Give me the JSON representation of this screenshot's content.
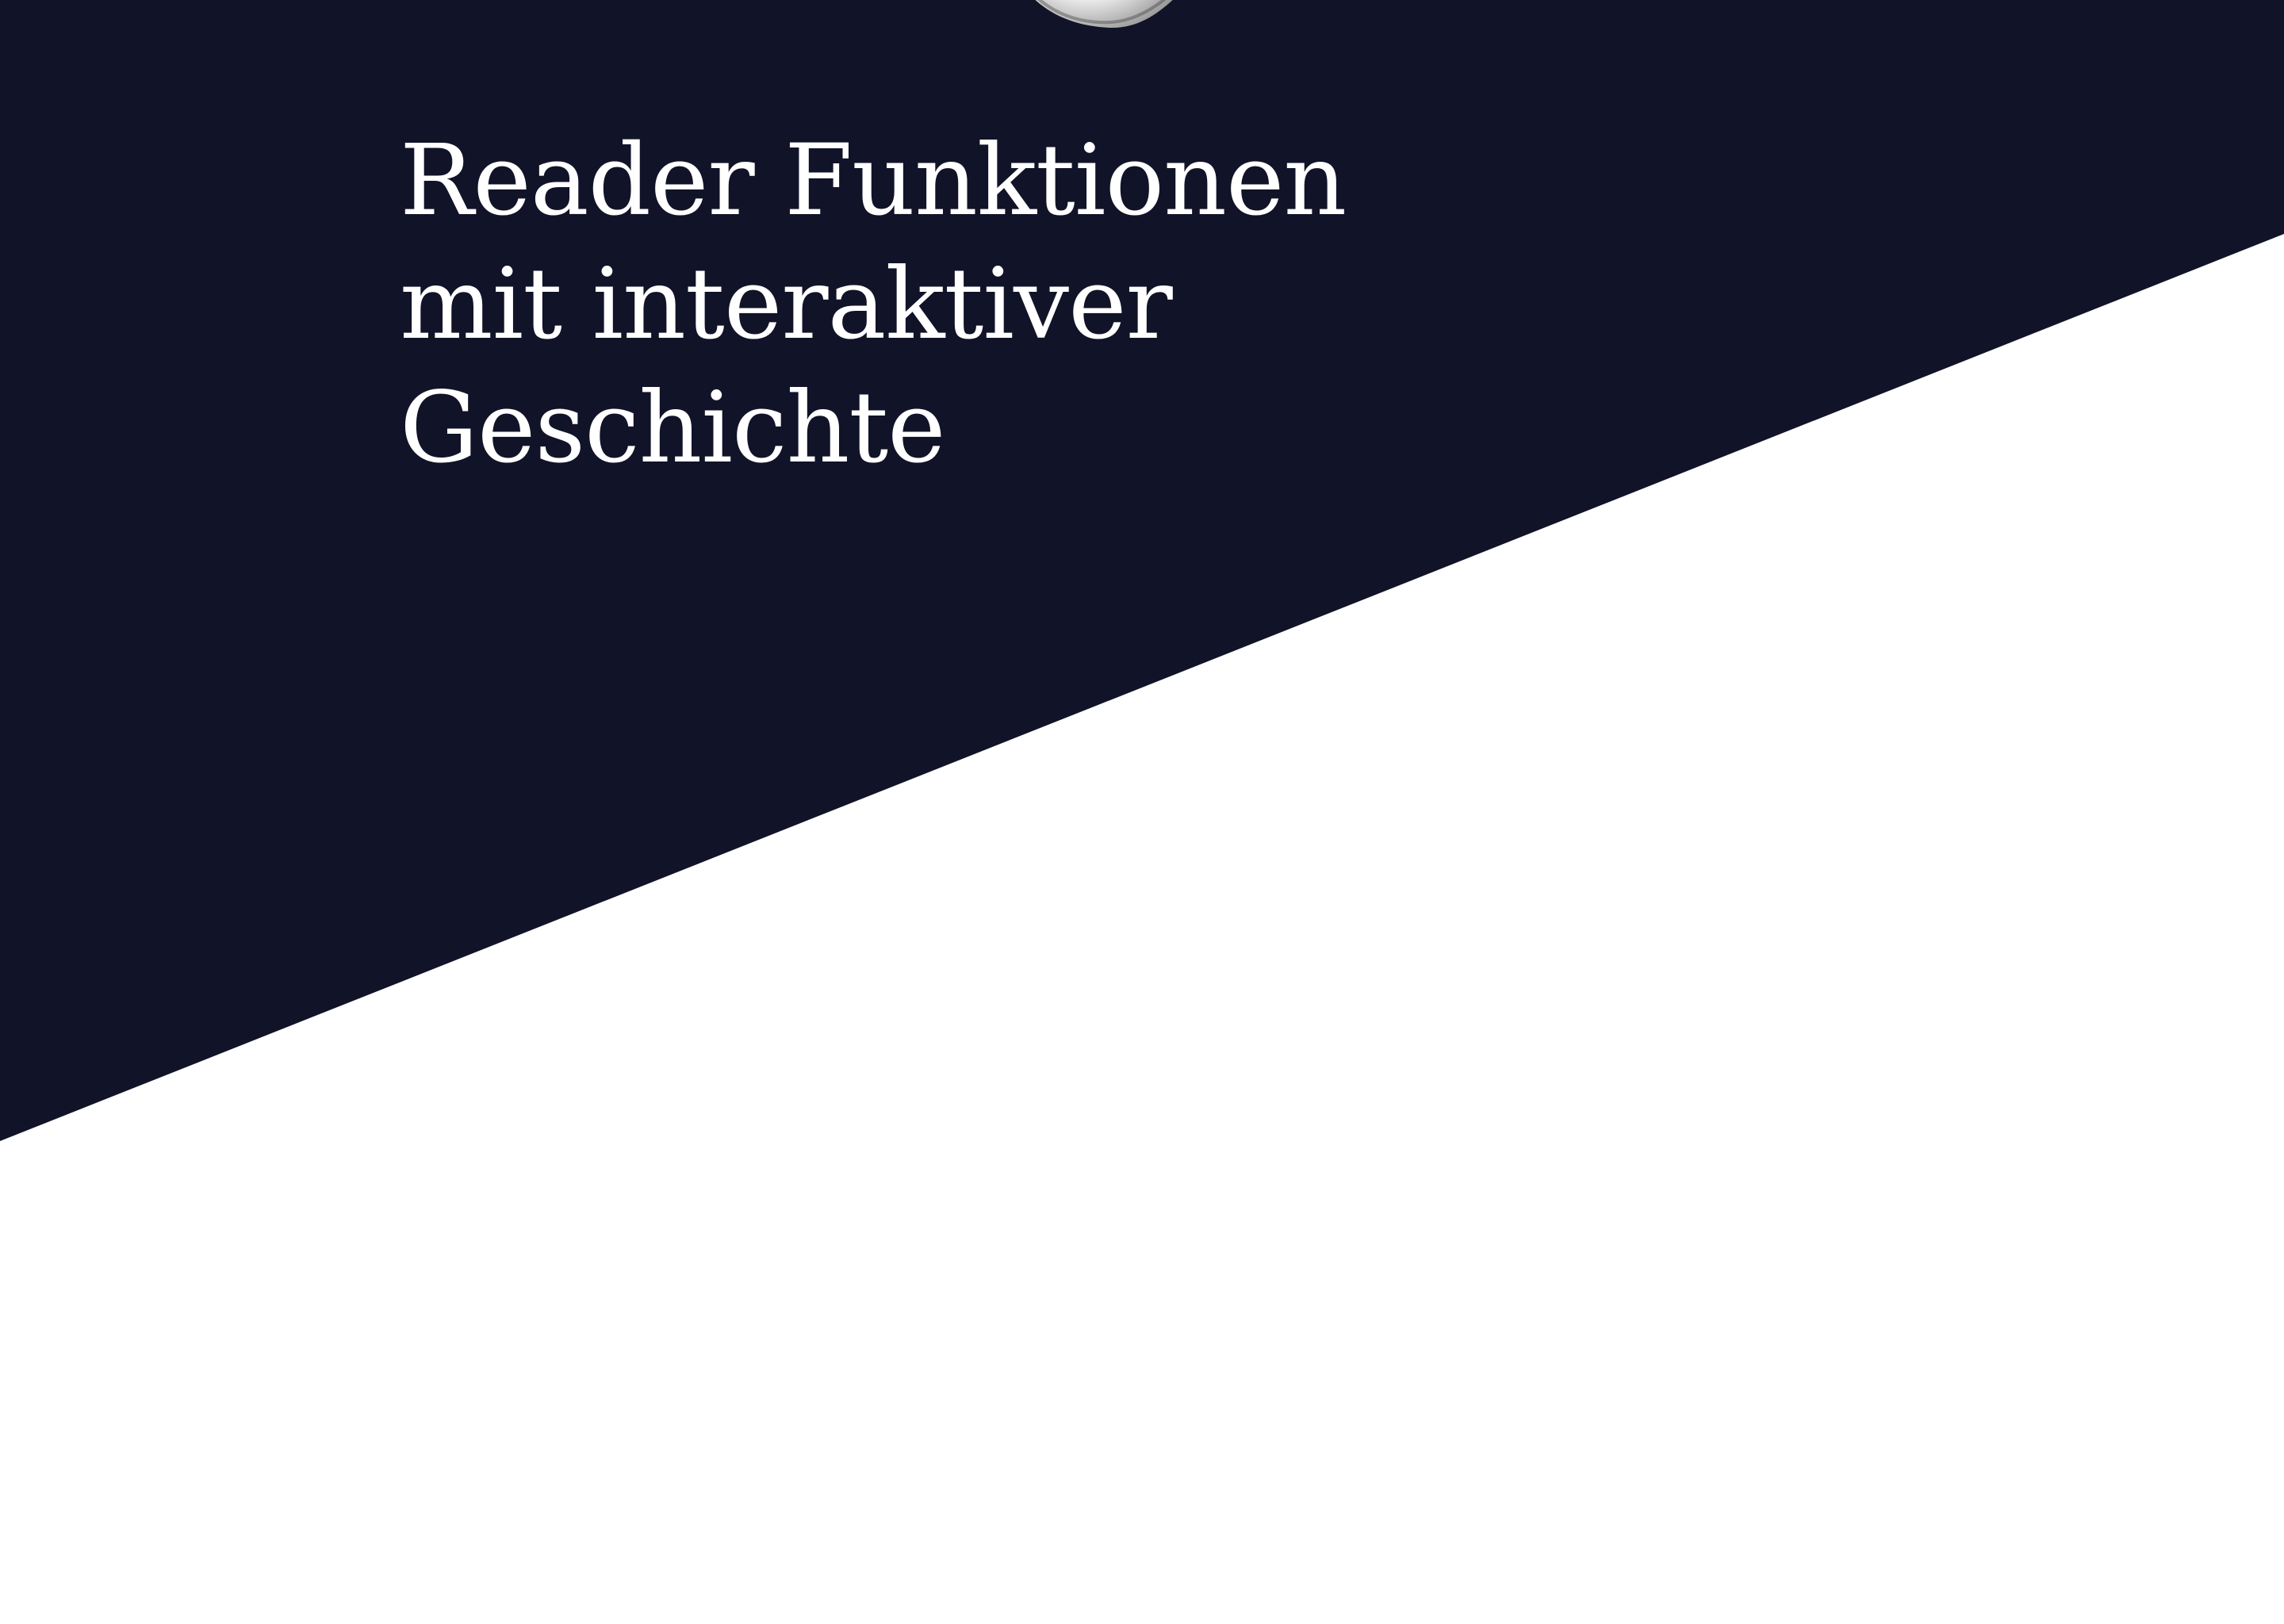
{
  "page": {
    "background_color": "#ffffff",
    "band_color": "#111328"
  },
  "hero": {
    "headline_lines": [
      "Reader Funktionen",
      "mit interaktiver",
      "Geschichte"
    ],
    "text_color": "#ffffff",
    "device_icon": "reader-device-edge"
  }
}
